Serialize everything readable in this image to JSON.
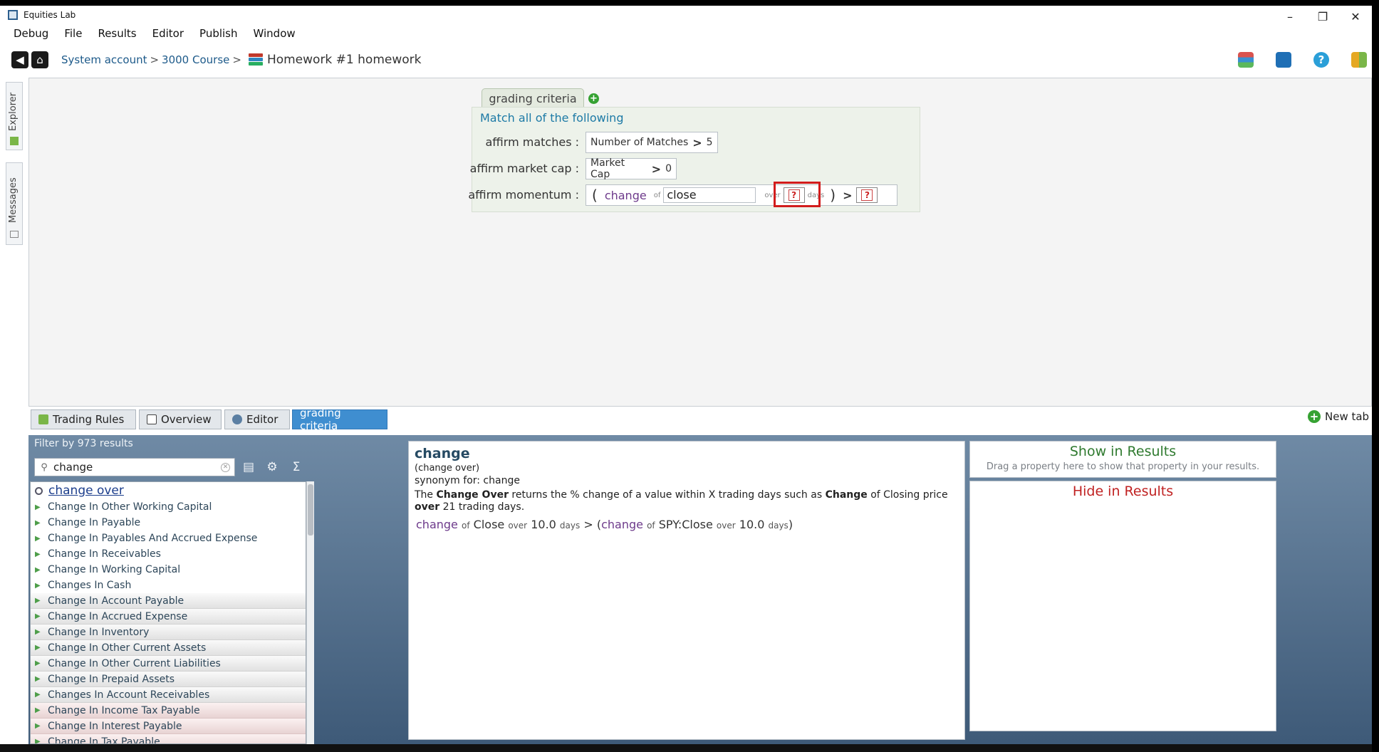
{
  "window": {
    "title": "Equities Lab"
  },
  "menu": [
    "Debug",
    "File",
    "Results",
    "Editor",
    "Publish",
    "Window"
  ],
  "breadcrumb": {
    "part1": "System account",
    "part2": "3000 Course",
    "sep": ">",
    "current": "Homework #1 homework"
  },
  "side_tabs": {
    "explorer": "Explorer",
    "messages": "Messages"
  },
  "criteria": {
    "tab_label": "grading criteria",
    "heading": "Match all of the following",
    "rule1": {
      "label": "affirm matches :",
      "field": "Number of Matches",
      "op": ">",
      "value": "5"
    },
    "rule2": {
      "label": "affirm market cap :",
      "field": "Market Cap",
      "op": ">",
      "value": "0"
    },
    "rule3": {
      "label": "affirm momentum :",
      "open": "(",
      "fn": "change",
      "of": "of",
      "input_value": "close",
      "over": "over",
      "days": "days",
      "close": ")",
      "op": ">",
      "q": "?"
    }
  },
  "bottom_tabs": [
    "Trading Rules",
    "Overview",
    "Editor",
    "grading criteria"
  ],
  "new_tab": "New tab",
  "filter": {
    "label": "Filter by 973 results",
    "search_value": "change"
  },
  "results_list": [
    "change over",
    "Change In Other Working Capital",
    "Change In Payable",
    "Change In Payables And Accrued Expense",
    "Change In Receivables",
    "Change In Working Capital",
    "Changes In Cash",
    "Change In Account Payable",
    "Change In Accrued Expense",
    "Change In Inventory",
    "Change In Other Current Assets",
    "Change In Other Current Liabilities",
    "Change In Prepaid Assets",
    "Changes In Account Receivables",
    "Change In Income Tax Payable",
    "Change In Interest Payable",
    "Change In Tax Payable"
  ],
  "description": {
    "title": "change",
    "subtitle": "(change over)",
    "synonym": "synonym for: change",
    "body_1": "The ",
    "body_b1": "Change Over",
    "body_2": " returns the % change of a value within X trading days such as ",
    "body_b2": "Change",
    "body_3": " of Closing price ",
    "body_b3": "over",
    "body_4": " 21 trading days.",
    "ex_change1": "change",
    "ex_of1": "of",
    "ex_close": "Close",
    "ex_over1": "over",
    "ex_n1": "10.0",
    "ex_days1": "days",
    "ex_gt": "> (",
    "ex_change2": "change",
    "ex_of2": "of",
    "ex_spy": "SPY:Close",
    "ex_over2": "over",
    "ex_n2": "10.0",
    "ex_days2": "days",
    "ex_end": ")"
  },
  "results_panel": {
    "show_title": "Show in Results",
    "show_hint": "Drag a property here to show that property in your results.",
    "hide_title": "Hide in Results"
  },
  "colors": {
    "accent": "#3f8ed0",
    "show": "#2f7a2f",
    "hide": "#c02222",
    "highlight": "#d21c1c"
  }
}
